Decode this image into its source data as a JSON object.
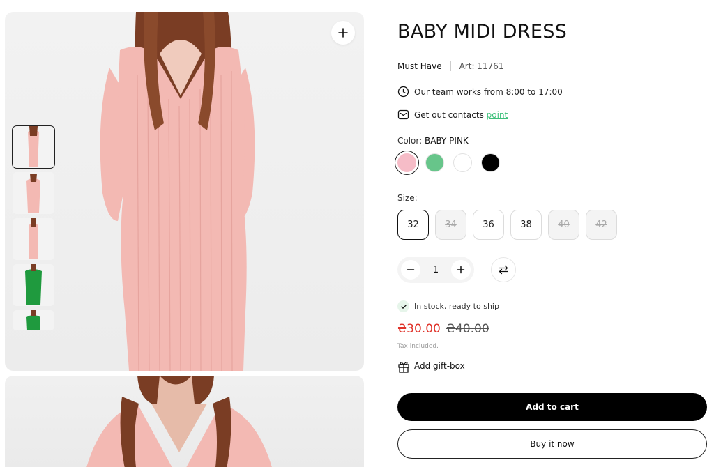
{
  "product": {
    "title": "BABY MIDI DRESS",
    "brand": "Must Have",
    "article": "Art: 11761"
  },
  "info": {
    "hours_text": "Our team works from 8:00 to 17:00",
    "contacts_text": "Get out contacts",
    "contacts_link": "point"
  },
  "color": {
    "label": "Color:",
    "selected": "BABY PINK",
    "swatches": [
      {
        "name": "baby-pink",
        "hex": "#f6bcc7"
      },
      {
        "name": "green",
        "hex": "#67c58a"
      },
      {
        "name": "white",
        "hex": "#ffffff"
      },
      {
        "name": "black",
        "hex": "#000000"
      }
    ]
  },
  "size": {
    "label": "Size:",
    "options": [
      {
        "value": "32",
        "available": true,
        "selected": true
      },
      {
        "value": "34",
        "available": false
      },
      {
        "value": "36",
        "available": true
      },
      {
        "value": "38",
        "available": true
      },
      {
        "value": "40",
        "available": false
      },
      {
        "value": "42",
        "available": false
      }
    ]
  },
  "quantity": {
    "value": "1"
  },
  "stock": {
    "text": "In stock, ready to ship"
  },
  "price": {
    "current": "₴30.00",
    "old": "₴40.00",
    "tax_note": "Tax included."
  },
  "gift": {
    "label": "Add gift-box"
  },
  "actions": {
    "add_to_cart": "Add to cart",
    "buy_now": "Buy it now"
  },
  "gallery": {
    "thumbnails": [
      {
        "name": "pink-dress-front",
        "color": "#f3b9b3"
      },
      {
        "name": "pink-dress-pose",
        "color": "#f3b9b3"
      },
      {
        "name": "pink-dress-side",
        "color": "#f3b9b3"
      },
      {
        "name": "green-dress",
        "color": "#1f9a3e"
      },
      {
        "name": "green-dress-partial",
        "color": "#1f9a3e"
      }
    ]
  }
}
